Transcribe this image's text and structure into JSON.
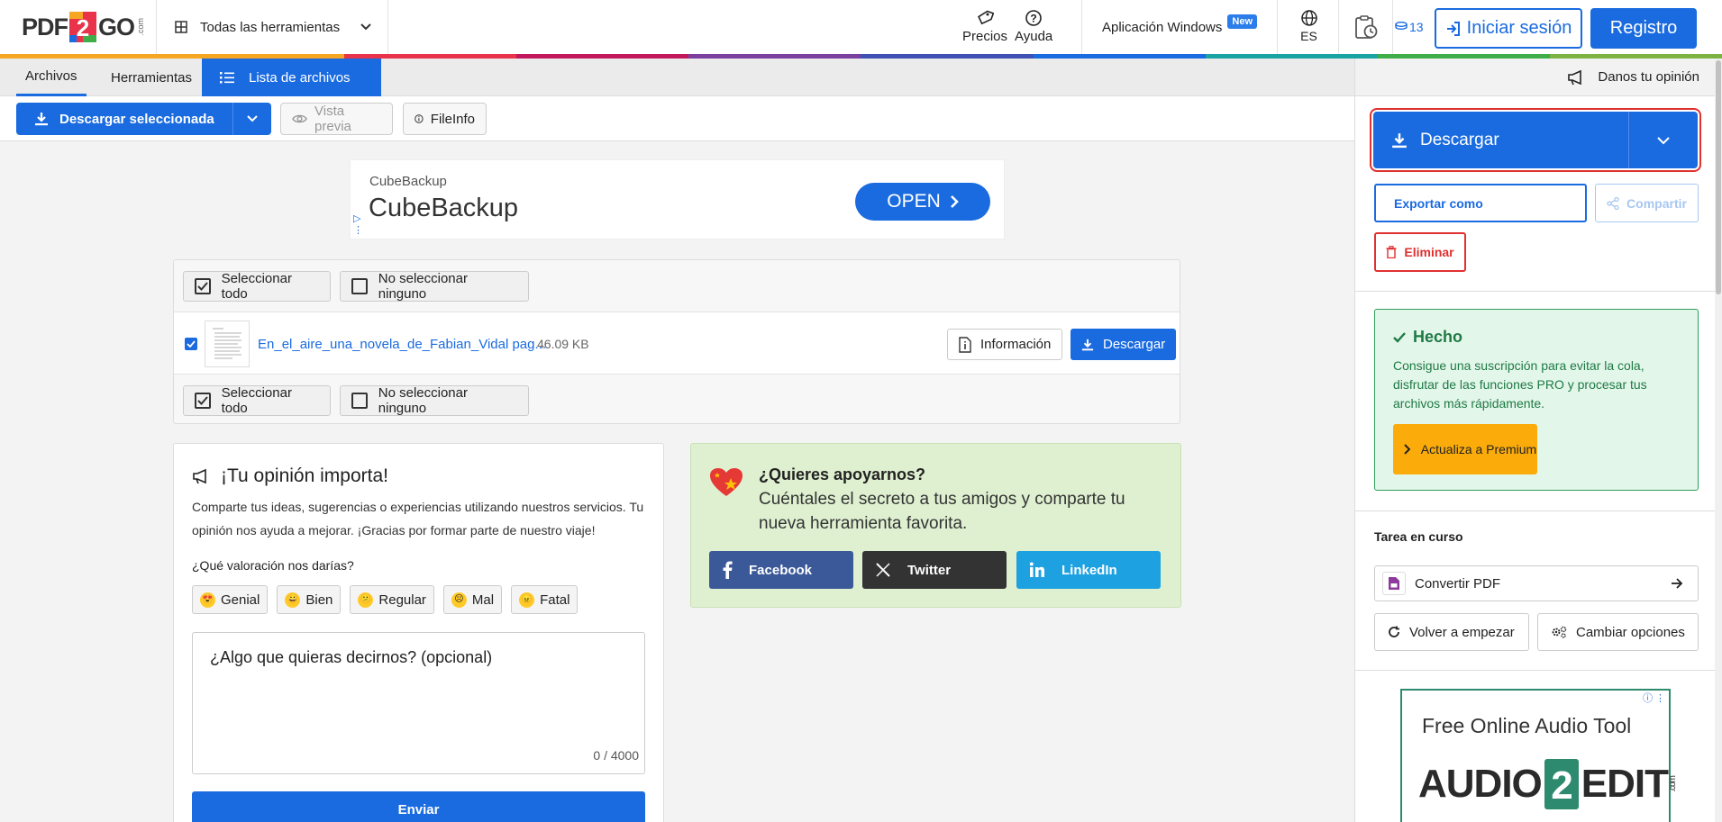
{
  "header": {
    "logo_left": "PDF",
    "logo_two": "2",
    "logo_right": "GO",
    "logo_com": ".com",
    "all_tools": "Todas las herramientas",
    "pricing": "Precios",
    "help": "Ayuda",
    "windows_app": "Aplicación Windows",
    "new_badge": "New",
    "language": "ES",
    "credits": "13",
    "login": "Iniciar sesión",
    "register": "Registro",
    "rainbow_colors": [
      "#f5a623",
      "#f5a623",
      "#e8334a",
      "#c2185b",
      "#7b3fa0",
      "#3f51b5",
      "#1a6be0",
      "#1aa3a3",
      "#3fae49",
      "#7cb342"
    ]
  },
  "tabs": {
    "files": "Archivos",
    "tools": "Herramientas",
    "file_list": "Lista de archivos"
  },
  "toolbar": {
    "download_selected": "Descargar seleccionada",
    "preview": "Vista previa",
    "fileinfo": "FileInfo"
  },
  "ad": {
    "small": "CubeBackup",
    "big": "CubeBackup",
    "open": "OPEN"
  },
  "files": {
    "select_all": "Seleccionar todo",
    "select_none": "No seleccionar ninguno",
    "items": [
      {
        "name": "En_el_aire_una_novela_de_Fabian_Vidal pag...",
        "size": "46.09 KB",
        "info": "Información",
        "download": "Descargar",
        "checked": true
      }
    ]
  },
  "feedback": {
    "title": "¡Tu opinión importa!",
    "desc": "Comparte tus ideas, sugerencias o experiencias utilizando nuestros servicios. Tu opinión nos ayuda a mejorar. ¡Gracias por formar parte de nuestro viaje!",
    "question": "¿Qué valoración nos darías?",
    "ratings": [
      "Genial",
      "Bien",
      "Regular",
      "Mal",
      "Fatal"
    ],
    "placeholder": "¿Algo que quieras decirnos? (opcional)",
    "counter": "0 / 4000",
    "send": "Enviar"
  },
  "support": {
    "title": "¿Quieres apoyarnos?",
    "text": "Cuéntales el secreto a tus amigos y comparte tu nueva herramienta favorita.",
    "facebook": "Facebook",
    "twitter": "Twitter",
    "linkedin": "LinkedIn"
  },
  "right": {
    "opinion": "Danos tu opinión",
    "download": "Descargar",
    "export": "Exportar como",
    "share": "Compartir",
    "delete": "Eliminar",
    "done_title": "Hecho",
    "done_text": "Consigue una suscripción para evitar la cola, disfrutar de las funciones PRO y procesar tus archivos más rápidamente.",
    "upgrade": "Actualiza a Premium",
    "task_title": "Tarea en curso",
    "convert_pdf": "Convertir PDF",
    "restart": "Volver a empezar",
    "change_options": "Cambiar opciones",
    "ad_title": "Free Online Audio Tool",
    "ad_left": "AUDIO",
    "ad_two": "2",
    "ad_right": "EDIT",
    "ad_com": ".com"
  },
  "colors": {
    "primary": "#1a6be0",
    "danger": "#e03030",
    "success": "#2e9e5b",
    "warning": "#fbac0b",
    "facebook": "#3b5998",
    "twitter": "#333333",
    "linkedin": "#1da1e0"
  }
}
